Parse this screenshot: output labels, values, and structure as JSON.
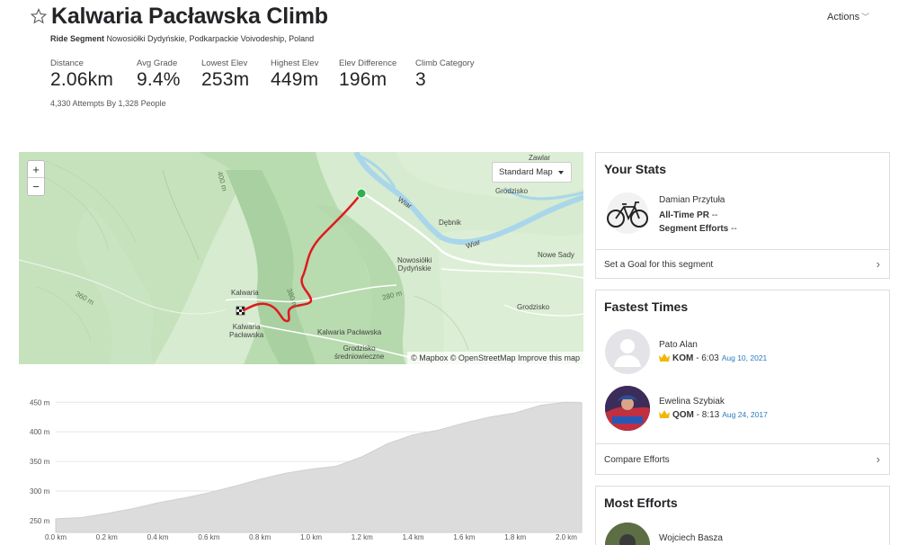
{
  "header": {
    "title": "Kalwaria Pacławska Climb",
    "actions_label": "Actions",
    "segment_type": "Ride Segment",
    "location": "Nowosiółki Dydyńskie, Podkarpackie Voivodeship, Poland",
    "attempts": "4,330 Attempts By 1,328 People"
  },
  "stats": [
    {
      "label": "Distance",
      "value": "2.06km"
    },
    {
      "label": "Avg Grade",
      "value": "9.4%"
    },
    {
      "label": "Lowest Elev",
      "value": "253m"
    },
    {
      "label": "Highest Elev",
      "value": "449m"
    },
    {
      "label": "Elev Difference",
      "value": "196m"
    },
    {
      "label": "Climb Category",
      "value": "3"
    }
  ],
  "map": {
    "zoom_in": "+",
    "zoom_out": "−",
    "style_label": "Standard Map",
    "attribution": "© Mapbox © OpenStreetMap Improve this map",
    "labels": {
      "zawlar": "Zawlar",
      "grodzisko_top": "Grodzisko",
      "debnik": "Dębnik",
      "wiar1": "Wiar",
      "wiar2": "Wiar",
      "nowosiolki": "Nowosiółki\nDydyńskie",
      "nowe_sady": "Nowe Sady",
      "grodzisko_right": "Grodzisko",
      "kalwaria_top": "Kalwaria",
      "kalwaria_bottom": "Kalwaria\nPacławska",
      "kalwaria_center": "Kalwaria Pacławska",
      "grodzisko_sred": "Grodzisko\nśredniowieczne",
      "c400": "400 m",
      "c360": "360 m",
      "c380": "380 m",
      "c280": "280 m"
    }
  },
  "elevation": {
    "y_ticks": [
      "450 m",
      "400 m",
      "350 m",
      "300 m",
      "250 m"
    ],
    "x_ticks": [
      "0.0 km",
      "0.2 km",
      "0.4 km",
      "0.6 km",
      "0.8 km",
      "1.0 km",
      "1.2 km",
      "1.4 km",
      "1.6 km",
      "1.8 km",
      "2.0 km"
    ],
    "profile_km": [
      0,
      0.1,
      0.2,
      0.3,
      0.4,
      0.5,
      0.6,
      0.7,
      0.8,
      0.9,
      1.0,
      1.1,
      1.2,
      1.3,
      1.4,
      1.5,
      1.6,
      1.7,
      1.8,
      1.9,
      2.0,
      2.06
    ],
    "profile_m": [
      253,
      255,
      262,
      270,
      280,
      288,
      297,
      308,
      320,
      330,
      337,
      342,
      358,
      380,
      395,
      403,
      415,
      425,
      432,
      445,
      450,
      449
    ]
  },
  "your_stats": {
    "title": "Your Stats",
    "name": "Damian Przytuła",
    "pr_label": "All-Time PR",
    "pr_value": "--",
    "efforts_label": "Segment Efforts",
    "efforts_value": "--",
    "goal_label": "Set a Goal for this segment"
  },
  "fastest": {
    "title": "Fastest Times",
    "entries": [
      {
        "name": "Pato Alan",
        "badge": "KOM",
        "time": "6:03",
        "date": "Aug 10, 2021"
      },
      {
        "name": "Ewelina Szybiak",
        "badge": "QOM",
        "time": "8:13",
        "date": "Aug 24, 2017"
      }
    ],
    "compare_label": "Compare Efforts"
  },
  "most_efforts": {
    "title": "Most Efforts",
    "entries": [
      {
        "name": "Wojciech Basza"
      }
    ]
  },
  "colors": {
    "route": "#e0191e",
    "start": "#2bb34a",
    "link": "#2b7bbf",
    "crown": "#f2b705"
  }
}
